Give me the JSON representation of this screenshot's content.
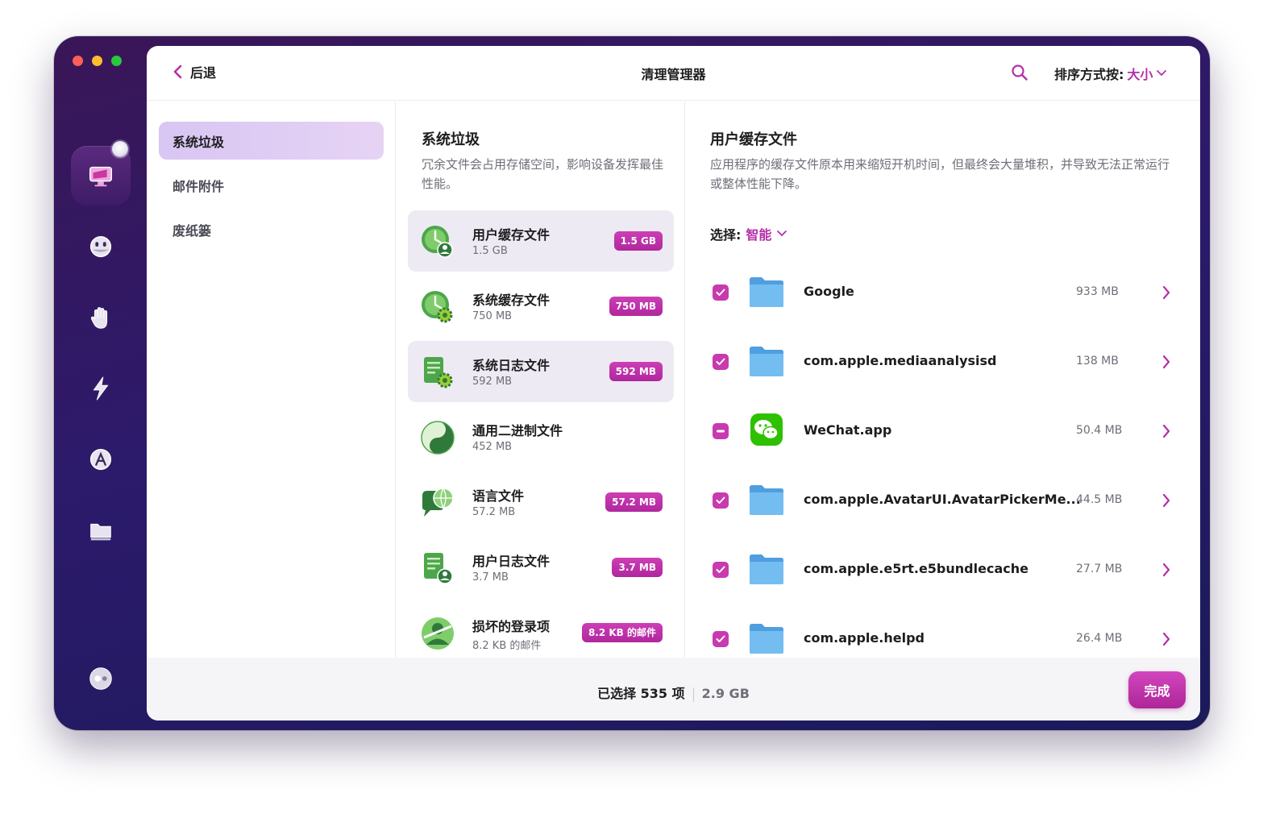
{
  "header": {
    "back_label": "后退",
    "title": "清理管理器",
    "sort_label": "排序方式按:",
    "sort_value": "大小"
  },
  "sidebar": {
    "items": [
      {
        "label": "系统垃圾",
        "selected": true
      },
      {
        "label": "邮件附件",
        "selected": false
      },
      {
        "label": "废纸篓",
        "selected": false
      }
    ]
  },
  "categories_panel": {
    "title": "系统垃圾",
    "description": "冗余文件会占用存储空间，影响设备发挥最佳性能。",
    "items": [
      {
        "name": "用户缓存文件",
        "size": "1.5 GB",
        "badge": "1.5 GB",
        "icon": "user-cache-icon"
      },
      {
        "name": "系统缓存文件",
        "size": "750 MB",
        "badge": "750 MB",
        "icon": "system-cache-icon"
      },
      {
        "name": "系统日志文件",
        "size": "592 MB",
        "badge": "592 MB",
        "icon": "system-log-icon"
      },
      {
        "name": "通用二进制文件",
        "size": "452 MB",
        "badge": "",
        "icon": "universal-binary-icon"
      },
      {
        "name": "语言文件",
        "size": "57.2 MB",
        "badge": "57.2 MB",
        "icon": "language-files-icon"
      },
      {
        "name": "用户日志文件",
        "size": "3.7 MB",
        "badge": "3.7 MB",
        "icon": "user-log-icon"
      },
      {
        "name": "损坏的登录项",
        "size": "8.2 KB 的邮件",
        "badge": "8.2 KB 的邮件",
        "icon": "broken-login-icon"
      }
    ]
  },
  "detail_panel": {
    "title": "用户缓存文件",
    "description": "应用程序的缓存文件原本用来缩短开机时间，但最终会大量堆积，并导致无法正常运行或整体性能下降。",
    "select_label": "选择:",
    "select_value": "智能",
    "files": [
      {
        "name": "Google",
        "size": "933 MB",
        "state": "checked",
        "icon": "folder-icon"
      },
      {
        "name": "com.apple.mediaanalysisd",
        "size": "138 MB",
        "state": "checked",
        "icon": "folder-icon"
      },
      {
        "name": "WeChat.app",
        "size": "50.4 MB",
        "state": "partial",
        "icon": "wechat-icon"
      },
      {
        "name": "com.apple.AvatarUI.AvatarPickerMe...",
        "size": "44.5 MB",
        "state": "checked",
        "icon": "folder-icon"
      },
      {
        "name": "com.apple.e5rt.e5bundlecache",
        "size": "27.7 MB",
        "state": "checked",
        "icon": "folder-icon"
      },
      {
        "name": "com.apple.helpd",
        "size": "26.4 MB",
        "state": "checked",
        "icon": "folder-icon"
      }
    ]
  },
  "footer": {
    "selected_count": "已选择 535 项",
    "total_size": "2.9 GB",
    "done_label": "完成"
  },
  "colors": {
    "accent": "#b52fa8",
    "badge": "#c03aab",
    "window": "#2c1a6b",
    "folder": "#5aaee8"
  }
}
